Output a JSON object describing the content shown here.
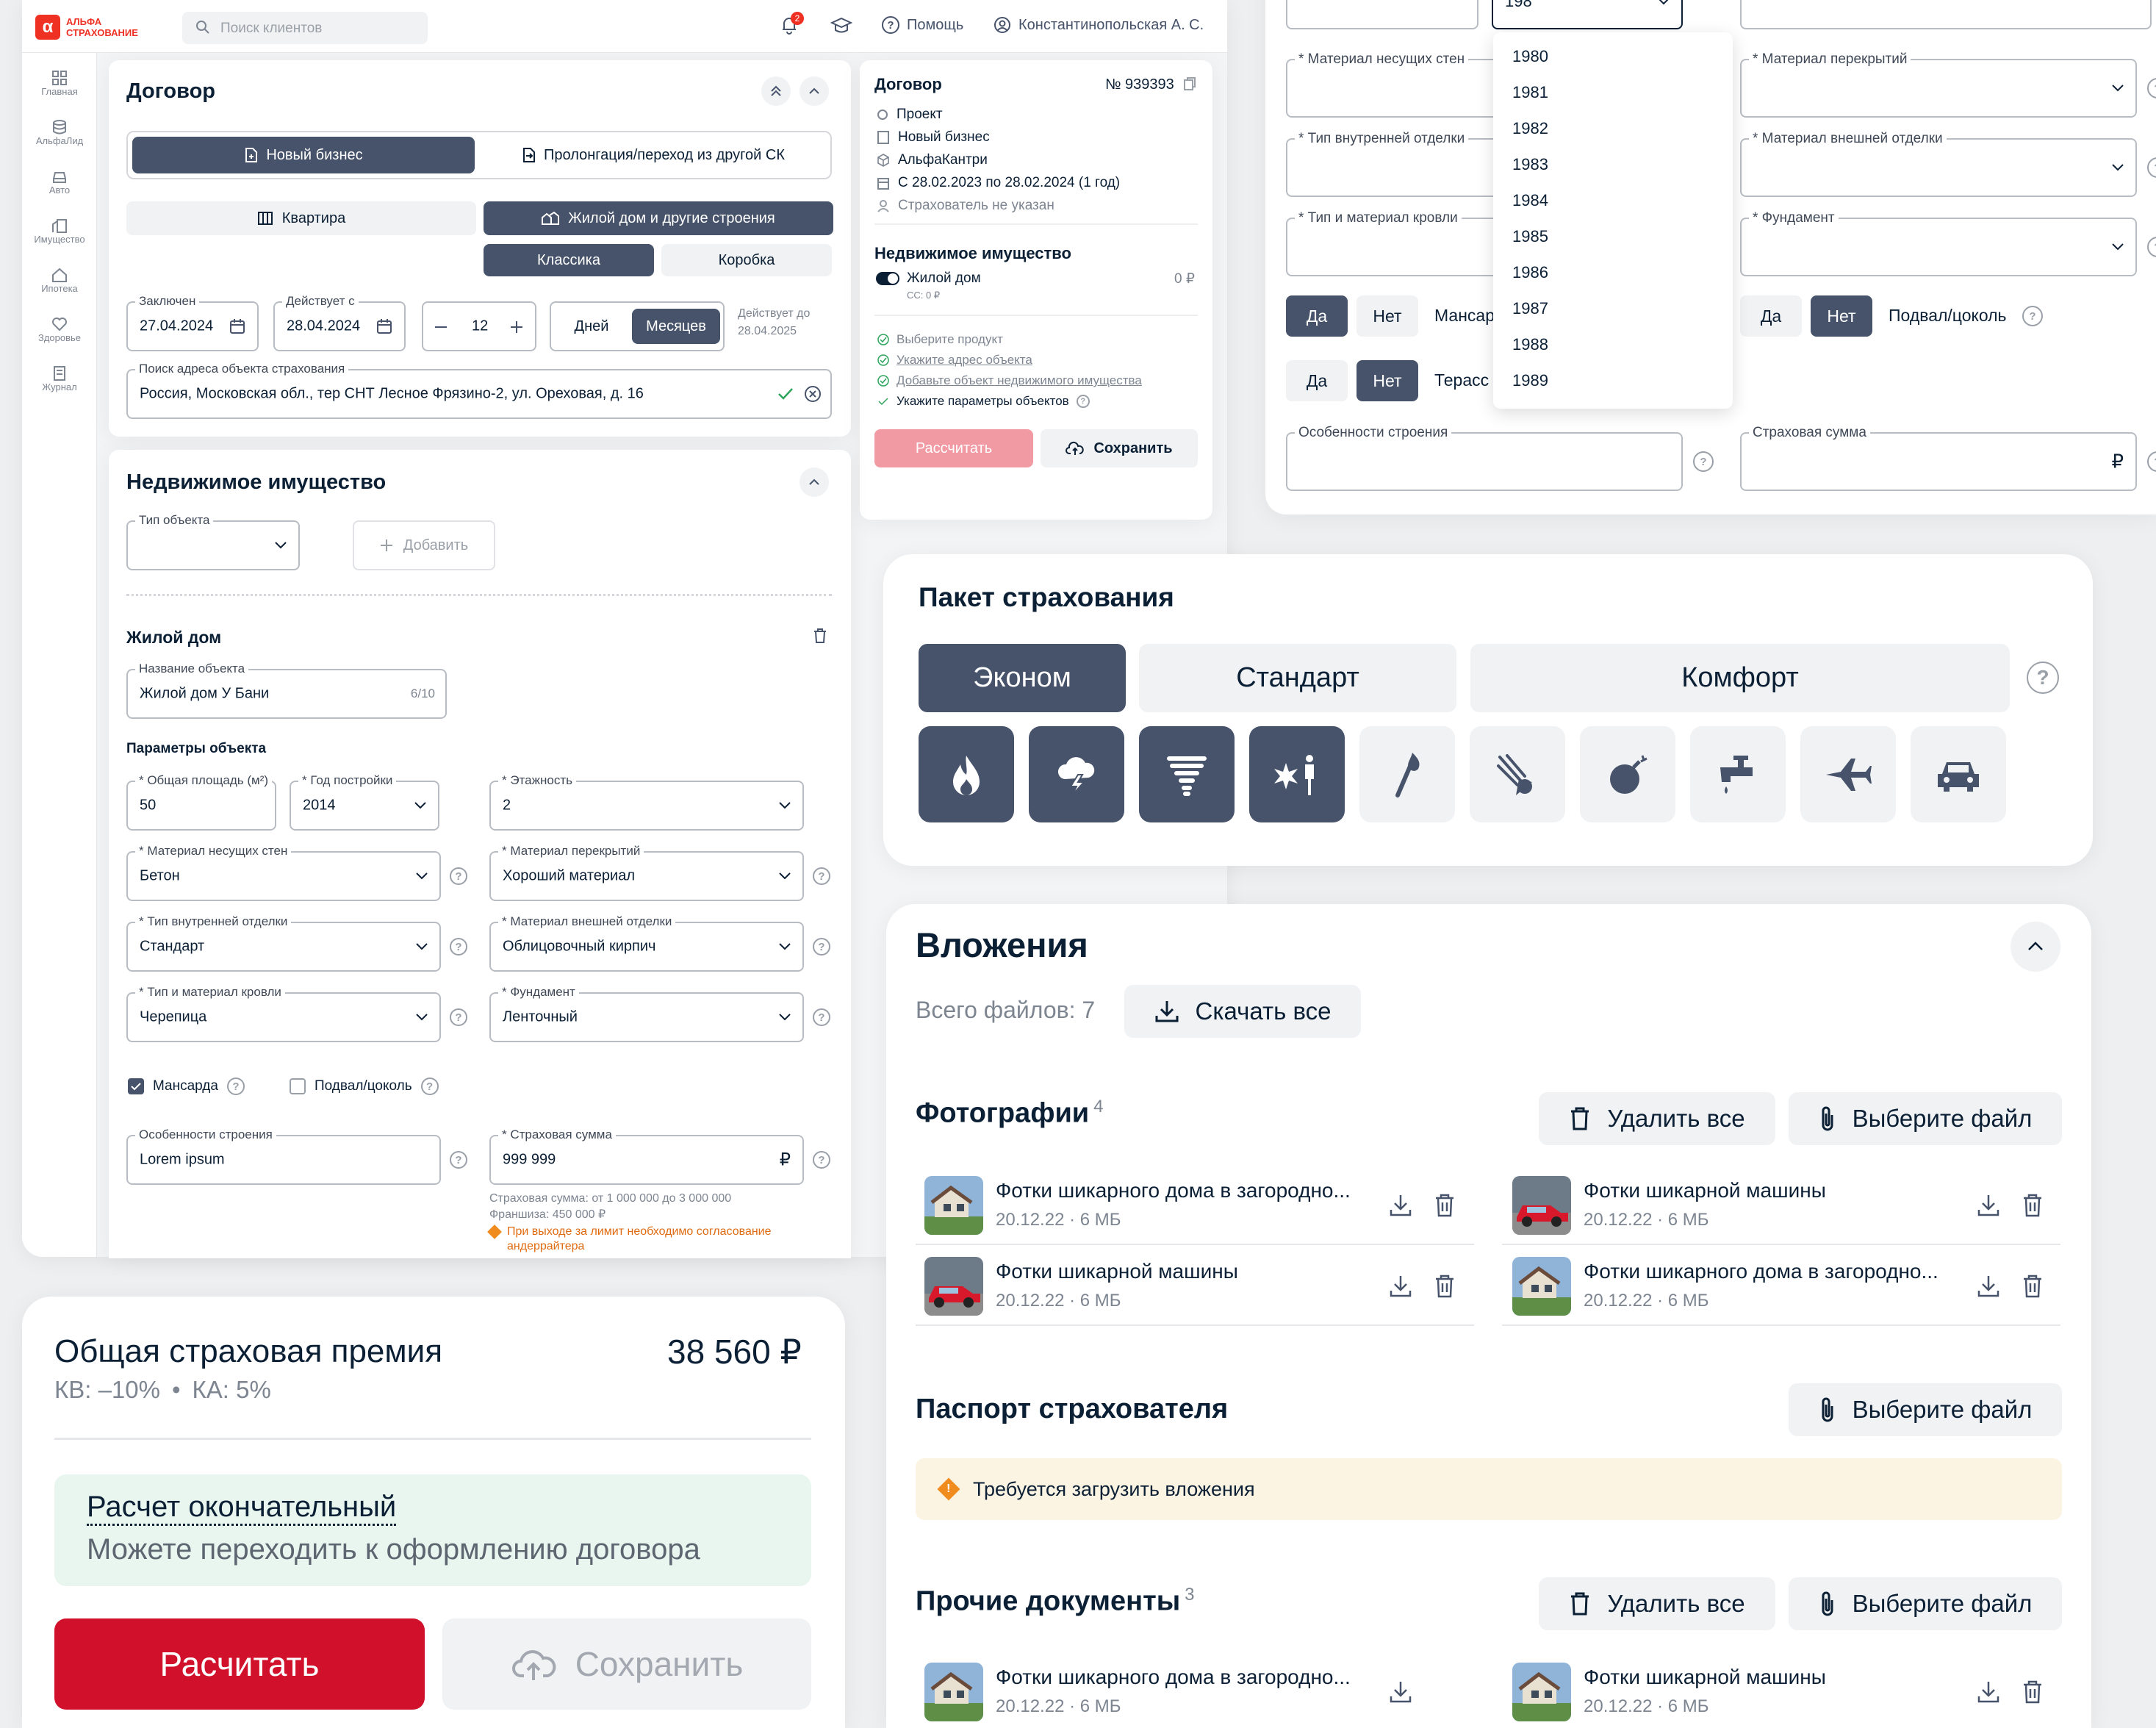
{
  "app": {
    "logo_line1": "АЛЬФА",
    "logo_line2": "СТРАХОВАНИЕ"
  },
  "header": {
    "search_placeholder": "Поиск клиентов",
    "notif_count": "2",
    "help": "Помощь",
    "user": "Константинопольская А. С."
  },
  "sidebar": [
    {
      "label": "Главная",
      "icon": "grid-icon"
    },
    {
      "label": "АльфаЛид",
      "icon": "database-icon"
    },
    {
      "label": "Авто",
      "icon": "car-icon"
    },
    {
      "label": "Имущество",
      "icon": "building-icon"
    },
    {
      "label": "Ипотека",
      "icon": "house-icon"
    },
    {
      "label": "Здоровье",
      "icon": "heart-icon"
    },
    {
      "label": "Журнал",
      "icon": "journal-icon"
    }
  ],
  "contract": {
    "title": "Договор",
    "seg1": [
      "Новый бизнес",
      "Пролонгация/переход из другой СК"
    ],
    "seg2": [
      "Квартира",
      "Жилой дом и другие строения"
    ],
    "seg3": [
      "Классика",
      "Коробка"
    ],
    "concluded_label": "Заключен",
    "concluded_value": "27.04.2024",
    "valid_from_label": "Действует с",
    "valid_from_value": "28.04.2024",
    "duration": "12",
    "unit_days": "Дней",
    "unit_months": "Месяцев",
    "valid_to_label": "Действует до",
    "valid_to_value": "28.04.2025",
    "address_label": "Поиск адреса объекта страхования",
    "address_value": "Россия, Московская обл., тер СНТ Лесное Фрязино-2, ул. Ореховая, д. 16"
  },
  "summary": {
    "title": "Договор",
    "number": "№ 939393",
    "items": [
      "Проект",
      "Новый бизнес",
      "АльфаКантри",
      "С 28.02.2023 по 28.02.2024 (1 год)",
      "Страхователь не указан"
    ],
    "realty_title": "Недвижимое имущество",
    "realty_item": "Жилой дом",
    "realty_sub": "СС: 0 ₽",
    "realty_amount": "0 ₽",
    "checks": [
      "Выберите продукт",
      "Укажите адрес объекта",
      "Добавьте объект недвижимого имущества",
      "Укажите параметры объектов"
    ],
    "calc_btn": "Рассчитать",
    "save_btn": "Сохранить"
  },
  "realty": {
    "title": "Недвижимое имущество",
    "type_label": "Тип объекта",
    "add_btn": "Добавить",
    "house_title": "Жилой дом",
    "name_label": "Название объекта",
    "name_value": "Жилой дом У Бани",
    "name_count": "6/10",
    "params_title": "Параметры объекта",
    "area_label": "* Общая площадь (м²)",
    "area_value": "50",
    "year_label": "* Год постройки",
    "year_value": "2014",
    "floors_label": "* Этажность",
    "floors_value": "2",
    "walls_label": "* Материал несущих стен",
    "walls_value": "Бетон",
    "ceil_label": "* Материал перекрытий",
    "ceil_value": "Хороший материал",
    "inner_label": "* Тип внутренней отделки",
    "inner_value": "Стандарт",
    "outer_label": "* Материал внешней отделки",
    "outer_value": "Облицовочный кирпич",
    "roof_label": "* Тип и материал кровли",
    "roof_value": "Черепица",
    "found_label": "* Фундамент",
    "found_value": "Ленточный",
    "attic": "Мансарда",
    "basement": "Подвал/цоколь",
    "feat_label": "Особенности строения",
    "feat_value": "Lorem ipsum",
    "sum_label": "* Страховая сумма",
    "sum_value": "999 999",
    "currency": "₽",
    "sum_hint1": "Страховая сумма: от 1 000 000 до 3 000 000",
    "sum_hint2": "Франшиза: 450 000 ₽",
    "warn1": "При выходе за лимит необходимо согласование",
    "warn2": "андеррайтера"
  },
  "zoom_form": {
    "year_value": "198",
    "years": [
      "1980",
      "1981",
      "1982",
      "1983",
      "1984",
      "1985",
      "1986",
      "1987",
      "1988",
      "1989"
    ],
    "walls_label": "* Материал несущих стен",
    "ceil_label": "* Материал перекрытий",
    "inner_label": "* Тип внутренней отделки",
    "outer_label": "* Материал внешней отделки",
    "roof_label": "* Тип и материал кровли",
    "found_label": "* Фундамент",
    "yes": "Да",
    "no": "Нет",
    "attic": "Мансар",
    "basement": "Подвал/цоколь",
    "terrace": "Терасс",
    "feat_label": "Особенности строения",
    "sum_label": "Страховая сумма",
    "currency": "₽"
  },
  "package": {
    "title": "Пакет страхования",
    "tabs": [
      "Эконом",
      "Стандарт",
      "Комфорт"
    ],
    "icons": [
      {
        "name": "fire-icon",
        "active": true
      },
      {
        "name": "storm-icon",
        "active": true
      },
      {
        "name": "tornado-icon",
        "active": true
      },
      {
        "name": "explosion-person-icon",
        "active": true
      },
      {
        "name": "match-icon",
        "active": false
      },
      {
        "name": "meteor-icon",
        "active": false
      },
      {
        "name": "bomb-icon",
        "active": false
      },
      {
        "name": "faucet-icon",
        "active": false
      },
      {
        "name": "plane-icon",
        "active": false
      },
      {
        "name": "car-icon",
        "active": false
      }
    ]
  },
  "attachments": {
    "title": "Вложения",
    "total": "Всего файлов: 7",
    "download_all": "Скачать все",
    "photos_title": "Фотографии",
    "photos_count": "4",
    "delete_all": "Удалить все",
    "choose_file": "Выберите файл",
    "file_house": "Фотки шикарного дома в загородно...",
    "file_car": "Фотки шикарной машины",
    "file_meta": "20.12.22 · 6 МБ",
    "passport_title": "Паспорт страхователя",
    "passport_warn": "Требуется загрузить вложения",
    "other_title": "Прочие документы",
    "other_count": "3"
  },
  "premium": {
    "title": "Общая страховая премия",
    "amount": "38 560 ₽",
    "kv": "КВ: –10%",
    "dot": "•",
    "ka": "КА: 5%",
    "final_title": "Расчет окончательный",
    "final_sub": "Можете переходить к оформлению договора",
    "calc_btn": "Расчитать",
    "save_btn": "Сохранить"
  },
  "colors": {
    "brand_red": "#ef3124",
    "calc_red": "#d1112b",
    "dark_btn": "#47536a",
    "success_bg": "#e9f6ef",
    "warn_bg": "#fcf4e3"
  }
}
